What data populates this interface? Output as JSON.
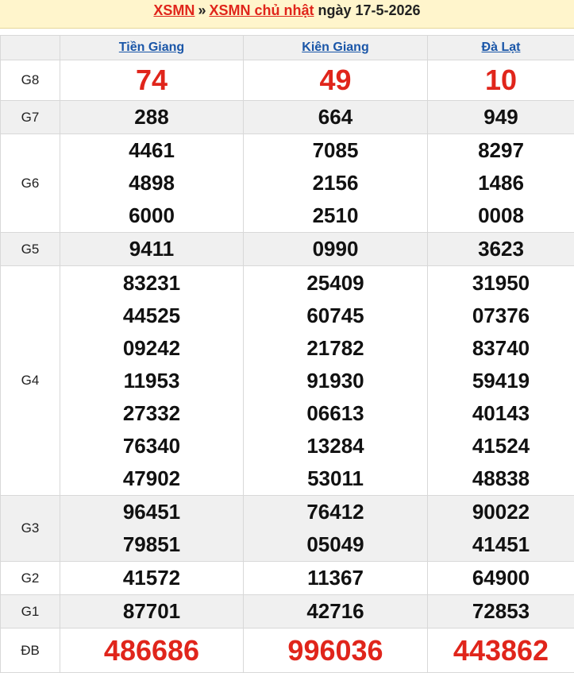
{
  "header": {
    "crumb1": "XSMN",
    "separator": "»",
    "crumb2": "XSMN chủ nhật",
    "date_text": "ngày 17-5-2026"
  },
  "provinces": [
    "Tiền Giang",
    "Kiên Giang",
    "Đà Lạt"
  ],
  "prizes": [
    {
      "label": "G8",
      "results": [
        [
          "74"
        ],
        [
          "49"
        ],
        [
          "10"
        ]
      ]
    },
    {
      "label": "G7",
      "results": [
        [
          "288"
        ],
        [
          "664"
        ],
        [
          "949"
        ]
      ]
    },
    {
      "label": "G6",
      "results": [
        [
          "4461",
          "4898",
          "6000"
        ],
        [
          "7085",
          "2156",
          "2510"
        ],
        [
          "8297",
          "1486",
          "0008"
        ]
      ]
    },
    {
      "label": "G5",
      "results": [
        [
          "9411"
        ],
        [
          "0990"
        ],
        [
          "3623"
        ]
      ]
    },
    {
      "label": "G4",
      "results": [
        [
          "83231",
          "44525",
          "09242",
          "11953",
          "27332",
          "76340",
          "47902"
        ],
        [
          "25409",
          "60745",
          "21782",
          "91930",
          "06613",
          "13284",
          "53011"
        ],
        [
          "31950",
          "07376",
          "83740",
          "59419",
          "40143",
          "41524",
          "48838"
        ]
      ]
    },
    {
      "label": "G3",
      "results": [
        [
          "96451",
          "79851"
        ],
        [
          "76412",
          "05049"
        ],
        [
          "90022",
          "41451"
        ]
      ]
    },
    {
      "label": "G2",
      "results": [
        [
          "41572"
        ],
        [
          "11367"
        ],
        [
          "64900"
        ]
      ]
    },
    {
      "label": "G1",
      "results": [
        [
          "87701"
        ],
        [
          "42716"
        ],
        [
          "72853"
        ]
      ]
    },
    {
      "label": "ĐB",
      "results": [
        [
          "486686"
        ],
        [
          "996036"
        ],
        [
          "443862"
        ]
      ]
    }
  ],
  "colors": {
    "accent_red": "#e0251b",
    "link_blue": "#1a56a8",
    "title_bg": "#fff5cc",
    "alt_row_bg": "#f0f0f0"
  }
}
